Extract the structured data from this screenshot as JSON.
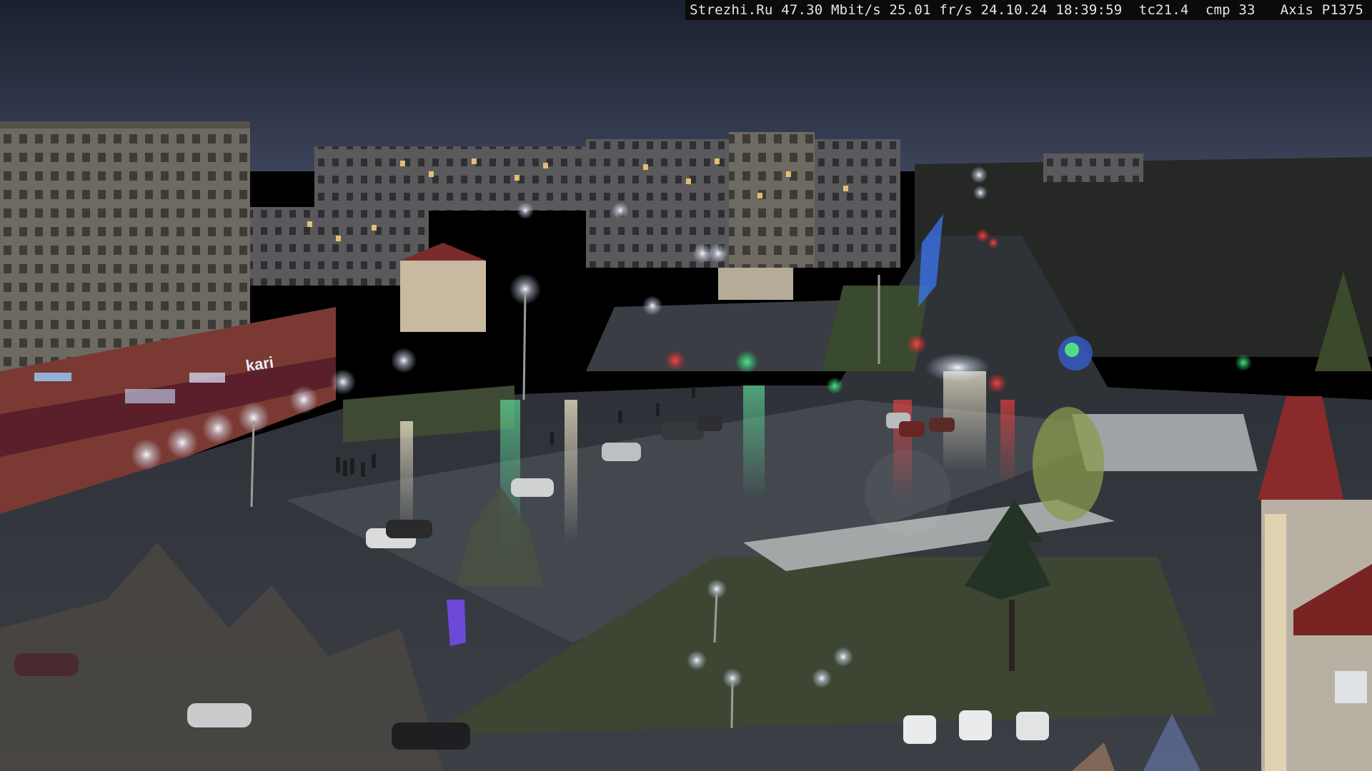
{
  "overlay": {
    "site": "Strezhi.Ru",
    "bitrate": "47.30 Mbit/s",
    "framerate": "25.01 fr/s",
    "date": "24.10.24",
    "time": "18:39:59",
    "tc": "tc21.4",
    "cmp": "cmp 33",
    "camera": "Axis P1375"
  },
  "signage": {
    "store_sign_left": "",
    "store_sign_center": "kari"
  },
  "palette": {
    "sky_top": "#1c2233",
    "sky_horizon": "#3a4056",
    "asphalt": "#3b3f44",
    "wet_highlight": "#8aa39a",
    "grass": "#3e4a33",
    "snow": "#a9acae",
    "building_panel": "#7b766c",
    "shop_facade": "#8a3b33",
    "red_roof": "#8a2a2a"
  }
}
